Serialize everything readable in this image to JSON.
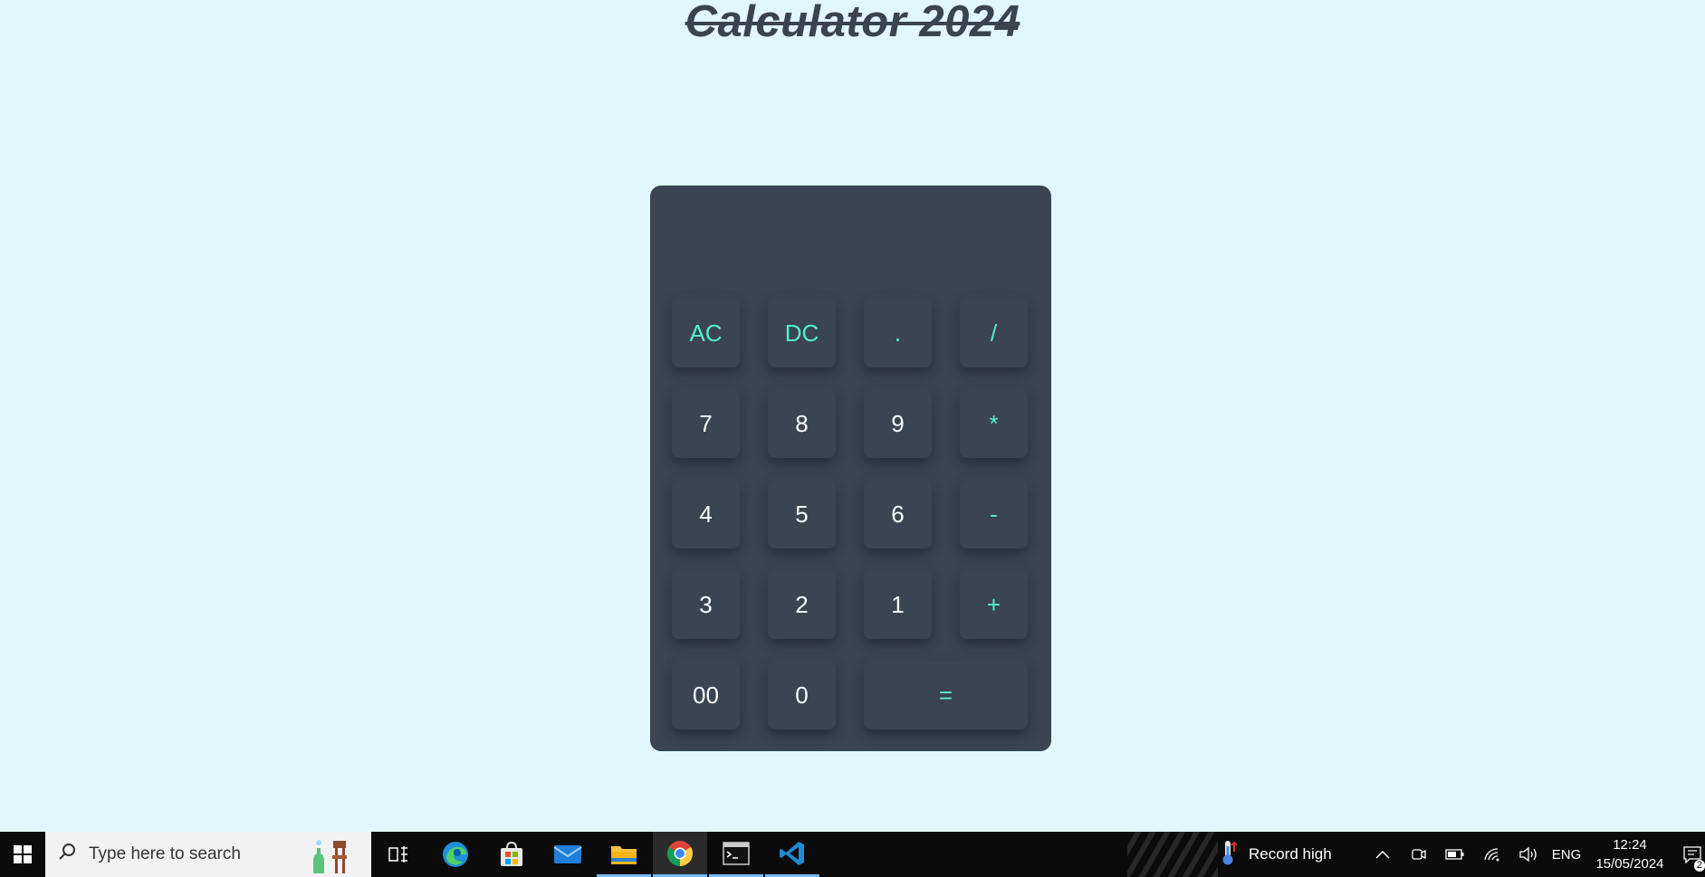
{
  "page": {
    "title": "Calculator 2024"
  },
  "calculator": {
    "display_value": "",
    "buttons": {
      "ac": "AC",
      "dc": "DC",
      "dot": ".",
      "divide": "/",
      "seven": "7",
      "eight": "8",
      "nine": "9",
      "multiply": "*",
      "four": "4",
      "five": "5",
      "six": "6",
      "minus": "-",
      "three": "3",
      "two": "2",
      "one": "1",
      "plus": "+",
      "double_zero": "00",
      "zero": "0",
      "equals": "="
    }
  },
  "colors": {
    "background": "#e1f7ff",
    "calculator_body": "#3a4452",
    "operator_accent": "#4ff0d2",
    "digit_text": "#ffffff"
  },
  "taskbar": {
    "search_placeholder": "Type here to search",
    "weather_text": "Record high",
    "language": "ENG",
    "time": "12:24",
    "date": "15/05/2024",
    "notification_count": "2",
    "icons": [
      "windows-start-icon",
      "search-icon",
      "task-view-icon",
      "edge-icon",
      "store-icon",
      "mail-icon",
      "file-explorer-icon",
      "chrome-icon",
      "terminal-icon",
      "vscode-icon",
      "thermometer-icon",
      "chevron-up-icon",
      "meet-now-icon",
      "battery-icon",
      "wifi-icon",
      "volume-icon",
      "notification-icon"
    ]
  }
}
